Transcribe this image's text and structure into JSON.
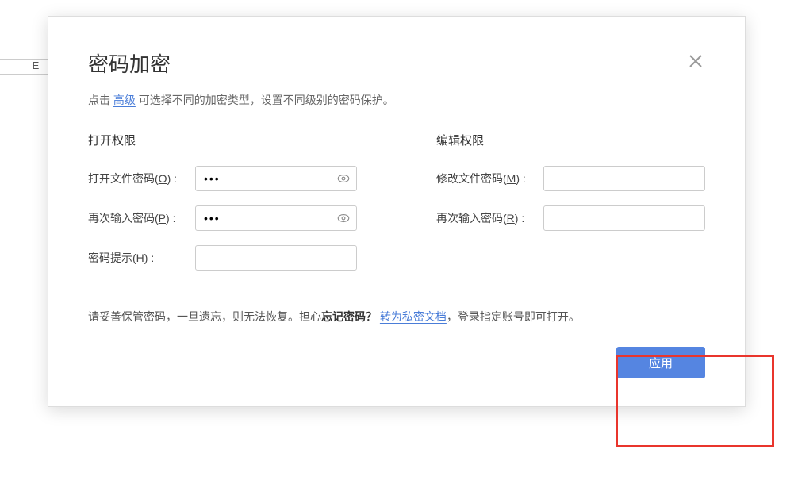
{
  "background": {
    "visible_col_header": "E"
  },
  "dialog": {
    "title": "密码加密",
    "hint_prefix": "点击 ",
    "hint_link": "高级",
    "hint_suffix": " 可选择不同的加密类型，设置不同级别的密码保护。",
    "open_section": {
      "title": "打开权限",
      "open_pwd_label_pre": "打开文件密码(",
      "open_pwd_key": "O",
      "open_pwd_label_post": ") :",
      "open_pwd_value": "•••",
      "confirm_label_pre": "再次输入密码(",
      "confirm_key": "P",
      "confirm_label_post": ") :",
      "confirm_value": "•••",
      "hint_label_pre": "密码提示(",
      "hint_key": "H",
      "hint_label_post": ") :",
      "hint_value": ""
    },
    "edit_section": {
      "title": "编辑权限",
      "mod_label_pre": "修改文件密码(",
      "mod_key": "M",
      "mod_label_post": ") :",
      "mod_value": "",
      "confirm_label_pre": "再次输入密码(",
      "confirm_key": "R",
      "confirm_label_post": ") :",
      "confirm_value": ""
    },
    "warn": {
      "pre": "请妥善保管密码，一旦遗忘，则无法恢复。担心",
      "bold": "忘记密码？",
      "link": "转为私密文档",
      "post": "，登录指定账号即可打开。"
    },
    "apply_label": "应用"
  }
}
